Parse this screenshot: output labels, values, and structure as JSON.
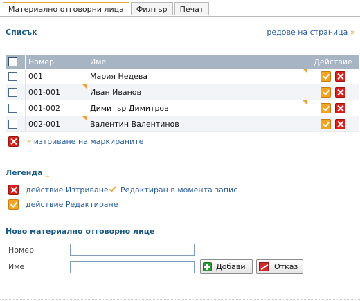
{
  "tabs": [
    {
      "label": "Материално отговорни лица"
    },
    {
      "label": "Филтър"
    },
    {
      "label": "Печат"
    }
  ],
  "list": {
    "title": "Списък",
    "rows_per_page_label": "редове на страница",
    "rows_per_page_arrow": "»",
    "columns": {
      "number": "Номер",
      "name": "Име",
      "action": "Действие"
    },
    "rows": [
      {
        "number": "001",
        "name": "Мария Недева"
      },
      {
        "number": "001-001",
        "name": "Иван Иванов"
      },
      {
        "number": "001-002",
        "name": "Димитър Димитров"
      },
      {
        "number": "002-001",
        "name": "Валентин Валентинов"
      }
    ],
    "delete_marked_prefix": "«",
    "delete_marked_label": "изтриване на маркираните"
  },
  "legend": {
    "title": "Легенда",
    "title_suffix": "_",
    "delete_label": "действие Изтриване",
    "edited_label": "Редактиран в момента запис",
    "edit_label": "действие Редактиране"
  },
  "new_form": {
    "title": "Ново материално отговорно лице",
    "number_label": "Номер",
    "number_value": "",
    "name_label": "Име",
    "name_value": "",
    "add_button": "Добави",
    "cancel_button": "Отказ"
  },
  "colors": {
    "accent_orange": "#e8a33a",
    "link_blue": "#2b5f9c",
    "heading_blue": "#1c5a88",
    "table_header": "#a6b4c4",
    "delete_red": "#d9201c",
    "edit_orange": "#f4a423"
  },
  "icons": {
    "edit": "edit-icon",
    "delete": "delete-icon",
    "add": "plus-icon",
    "cancel": "cancel-icon",
    "edited_marker": "checkmark-icon"
  }
}
